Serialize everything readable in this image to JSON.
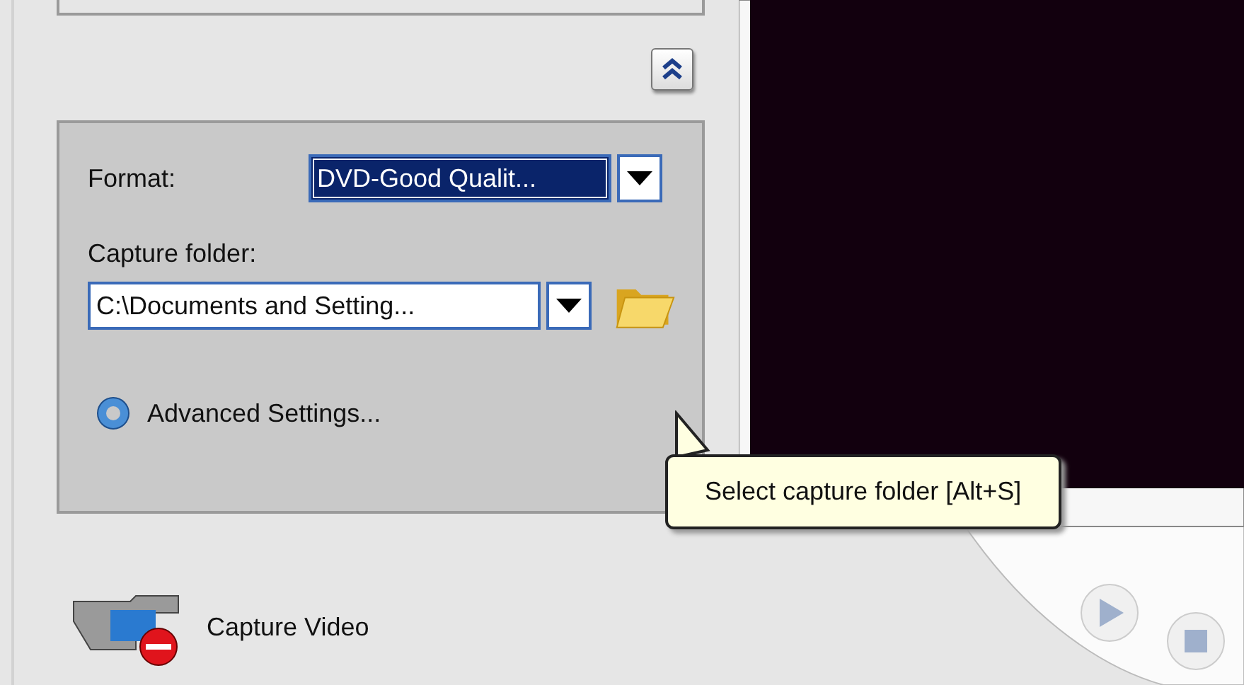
{
  "format": {
    "label": "Format:",
    "value": "DVD-Good Qualit...",
    "selected": true
  },
  "capture_folder": {
    "label": "Capture folder:",
    "value": "C:\\Documents and Setting...",
    "selected": false
  },
  "advanced_settings": {
    "label": "Advanced Settings..."
  },
  "capture_video": {
    "label": "Capture Video"
  },
  "tooltip": {
    "text": "Select capture folder [Alt+S]"
  }
}
